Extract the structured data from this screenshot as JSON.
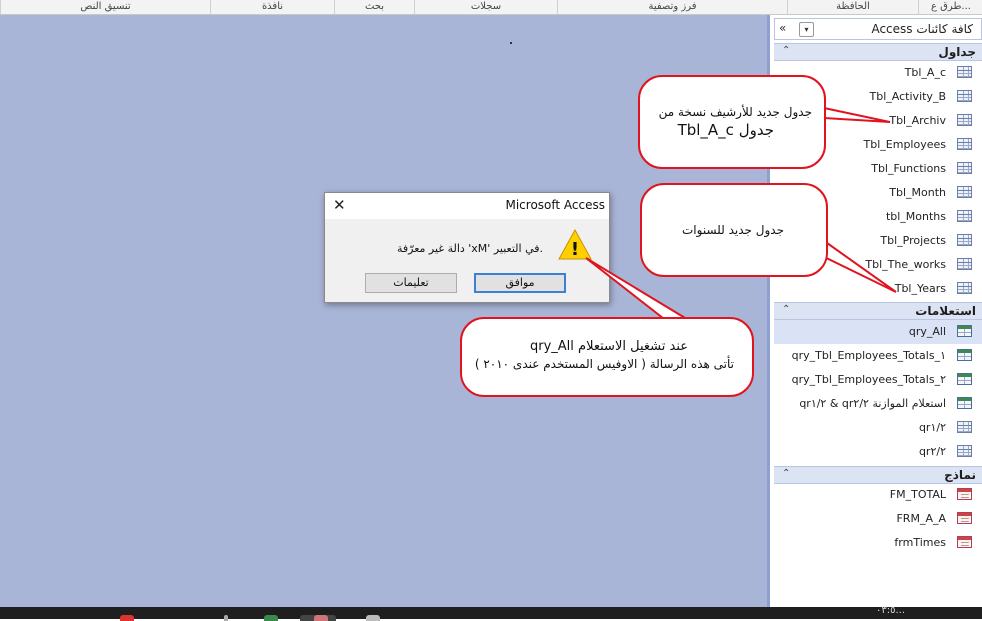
{
  "ribbon": {
    "groups": [
      "طرق ع...",
      "الحافظة",
      "فرز وتصفية",
      "سجلات",
      "بحث",
      "نافذة",
      "تنسيق النص"
    ]
  },
  "nav": {
    "title": "كافة كائنات Access",
    "collapse_glyph": "«",
    "dropdown_glyph": "▾",
    "sections": {
      "tables": {
        "title": "جداول",
        "items": [
          "Tbl_A_c",
          "Tbl_Activity_B",
          "Tbl_Archiv",
          "Tbl_Employees",
          "Tbl_Functions",
          "Tbl_Month",
          "tbl_Months",
          "Tbl_Projects",
          "Tbl_The_works",
          "Tbl_Years"
        ]
      },
      "queries": {
        "title": "استعلامات",
        "items": [
          "qry_All",
          "qry_Tbl_Employees_Totals_١",
          "qry_Tbl_Employees_Totals_٢",
          "استعلام الموازنة qr٢/٢ & qr١/٢",
          "qr١/٢",
          "qr٢/٢"
        ]
      },
      "forms": {
        "title": "نماذج",
        "items": [
          "FM_TOTAL",
          "FRM_A_A",
          "frmTimes"
        ]
      }
    },
    "chevron": "⌃"
  },
  "dialog": {
    "title": "Microsoft Access",
    "close_glyph": "✕",
    "message": "دالة غير معرّفة 'xM' في التعبير.",
    "ok_label": "موافق",
    "help_label": "تعليمات",
    "warn_mark": "!"
  },
  "callouts": {
    "archive_line1": "جدول جديد للأرشيف نسخة من",
    "archive_line2": "جدول Tbl_A_c",
    "years": "جدول جديد للسنوات",
    "query_line1": "عند تشغيل الاستعلام  qry_All",
    "query_line2": "تأتى هذه الرسالة ( الاوفيس المستخدم عندى ٢٠١٠ )"
  },
  "taskbar": {
    "time": "٠٣:٥..."
  },
  "colors": {
    "workspace": "#a9b5d7",
    "callout_border": "#e0141e",
    "ok_focus": "#3c7fd6"
  }
}
